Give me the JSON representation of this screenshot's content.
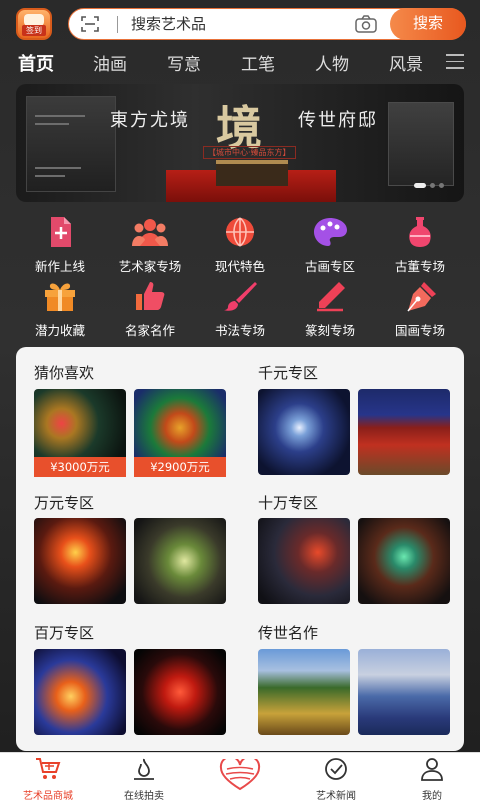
{
  "header": {
    "signin_label": "签到",
    "search_placeholder": "搜索艺术品",
    "search_button": "搜索"
  },
  "tabs": [
    {
      "label": "首页",
      "active": true
    },
    {
      "label": "油画"
    },
    {
      "label": "写意"
    },
    {
      "label": "工笔"
    },
    {
      "label": "人物"
    },
    {
      "label": "风景"
    }
  ],
  "banner": {
    "left_text": "東方尤境",
    "center_char": "境",
    "right_text": "传世府邸",
    "subtitle": "【城市中心·臻品东方】",
    "page_count": 3,
    "active_page": 1
  },
  "categories": [
    {
      "label": "新作上线",
      "icon": "new-doc-icon"
    },
    {
      "label": "艺术家专场",
      "icon": "artists-group-icon"
    },
    {
      "label": "现代特色",
      "icon": "globe-icon"
    },
    {
      "label": "古画专区",
      "icon": "palette-icon"
    },
    {
      "label": "古董专场",
      "icon": "vase-icon"
    },
    {
      "label": "潜力收藏",
      "icon": "gift-box-icon"
    },
    {
      "label": "名家名作",
      "icon": "thumbs-up-icon"
    },
    {
      "label": "书法专场",
      "icon": "brush-icon"
    },
    {
      "label": "篆刻专场",
      "icon": "pen-icon"
    },
    {
      "label": "国画专场",
      "icon": "fountain-pen-icon"
    }
  ],
  "sections": [
    {
      "title": "猜你喜欢",
      "items": [
        {
          "price": "¥3000万元"
        },
        {
          "price": "¥2900万元"
        }
      ]
    },
    {
      "title": "千元专区",
      "items": [
        {},
        {}
      ]
    },
    {
      "title": "万元专区",
      "items": [
        {},
        {}
      ]
    },
    {
      "title": "十万专区",
      "items": [
        {},
        {}
      ]
    },
    {
      "title": "百万专区",
      "items": [
        {},
        {}
      ]
    },
    {
      "title": "传世名作",
      "items": [
        {},
        {}
      ]
    }
  ],
  "bottom_nav": [
    {
      "label": "艺术品商城",
      "icon": "shopping-cart-icon",
      "active": true
    },
    {
      "label": "在线拍卖",
      "icon": "auction-icon"
    },
    {
      "label": "",
      "icon": "heart-icon"
    },
    {
      "label": "艺术新闻",
      "icon": "check-circle-icon"
    },
    {
      "label": "我的",
      "icon": "user-icon"
    }
  ],
  "colors": {
    "accent": "#e8582a",
    "background": "#2b2b2b",
    "active_nav": "#e8412a"
  }
}
